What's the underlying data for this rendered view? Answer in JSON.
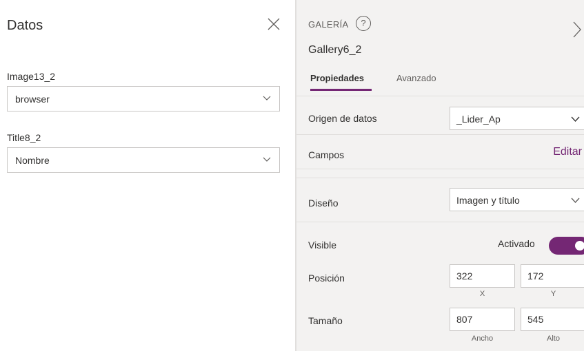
{
  "left_panel": {
    "title": "Datos",
    "fields": [
      {
        "label": "Image13_2",
        "value": "browser"
      },
      {
        "label": "Title8_2",
        "value": "Nombre"
      }
    ]
  },
  "right_panel": {
    "control_kind": "GALERÍA",
    "help_glyph": "?",
    "control_name": "Gallery6_2",
    "tabs": [
      {
        "label": "Propiedades",
        "active": true
      },
      {
        "label": "Avanzado",
        "active": false
      }
    ],
    "properties": {
      "data_source": {
        "label": "Origen de datos",
        "value": "_Lider_Ap"
      },
      "fields": {
        "label": "Campos",
        "action": "Editar"
      },
      "layout": {
        "label": "Diseño",
        "value": "Imagen y título"
      },
      "visible": {
        "label": "Visible",
        "state_text": "Activado",
        "on": true
      },
      "position": {
        "label": "Posición",
        "x": "322",
        "y": "172",
        "x_caption": "X",
        "y_caption": "Y"
      },
      "size": {
        "label": "Tamaño",
        "width": "807",
        "height": "545",
        "width_caption": "Ancho",
        "height_caption": "Alto"
      }
    }
  },
  "colors": {
    "accent": "#742774",
    "panel_bg": "#f3f2f1",
    "border": "#c8c6c4",
    "text": "#323130"
  },
  "icons": [
    "close-icon",
    "chevron-down-icon",
    "help-circle-icon",
    "chevron-right-icon"
  ]
}
